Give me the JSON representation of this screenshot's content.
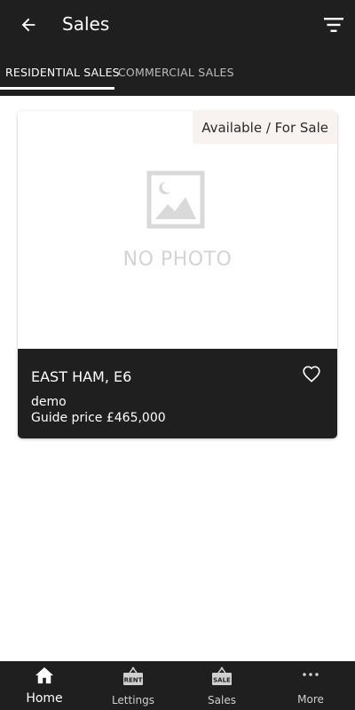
{
  "header": {
    "title": "Sales",
    "back_icon": "arrow-left-icon",
    "filter_icon": "filter-icon"
  },
  "tabs": [
    {
      "label": "RESIDENTIAL SALES",
      "active": true
    },
    {
      "label": "COMMERCIAL SALES",
      "active": false
    }
  ],
  "listing": {
    "status": "Available / For Sale",
    "placeholder_text": "NO PHOTO",
    "address": "EAST HAM, E6",
    "description": "demo",
    "price": "Guide price £465,000",
    "favorite_icon": "heart-outline-icon"
  },
  "bottom_nav": [
    {
      "label": "Home",
      "icon": "home-icon",
      "active": true
    },
    {
      "label": "Lettings",
      "icon": "rent-sign-icon",
      "badge_text": "RENT"
    },
    {
      "label": "Sales",
      "icon": "sale-sign-icon",
      "badge_text": "SALE"
    },
    {
      "label": "More",
      "icon": "more-dots-icon"
    }
  ],
  "colors": {
    "bar_background": "#1f1f1f",
    "badge_background": "#f8f3f1",
    "placeholder_gray": "#d4d4d4"
  }
}
